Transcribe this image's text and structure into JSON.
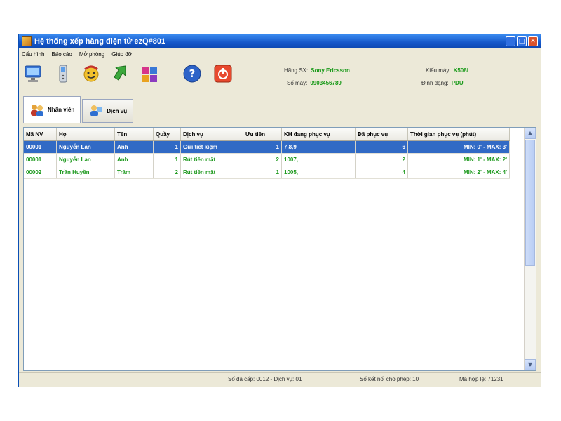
{
  "window": {
    "title": "Hệ thống xếp hàng điện tử ezQ#801"
  },
  "menu": [
    "Cấu hình",
    "Báo cáo",
    "Mở phòng",
    "Giúp đỡ"
  ],
  "toolbar": {
    "icons": [
      "monitor-icon",
      "phone-icon",
      "refresh-face-icon",
      "green-arrow-icon",
      "puzzle-icon",
      "help-icon",
      "power-icon"
    ]
  },
  "device_info": {
    "maker_label": "Hãng SX:",
    "maker_value": "Sony Ericsson",
    "phone_label": "Số máy:",
    "phone_value": "0903456789",
    "model_label": "Kiểu máy:",
    "model_value": "K508i",
    "format_label": "Định dạng:",
    "format_value": "PDU"
  },
  "tabs": [
    {
      "label": "Nhân viên",
      "active": true
    },
    {
      "label": "Dịch vụ",
      "active": false
    }
  ],
  "table": {
    "columns": [
      "Mã NV",
      "Họ",
      "Tên",
      "Quầy",
      "Dịch vụ",
      "Ưu tiên",
      "KH đang phục vụ",
      "Đã phục vụ",
      "Thời gian phục vụ (phút)"
    ],
    "rows": [
      [
        "00001",
        "Nguyễn Lan",
        "Anh",
        "1",
        "Gửi tiết kiệm",
        "1",
        "7,8,9",
        "6",
        "MIN: 0' - MAX: 3'"
      ],
      [
        "00001",
        "Nguyễn Lan",
        "Anh",
        "1",
        "Rút tiền mặt",
        "2",
        "1007,",
        "2",
        "MIN: 1' - MAX: 2'"
      ],
      [
        "00002",
        "Trần Huyền",
        "Trâm",
        "2",
        "Rút tiền mặt",
        "1",
        "1005,",
        "4",
        "MIN: 2' - MAX: 4'"
      ]
    ],
    "selected_row": 0
  },
  "status": {
    "calls": "Số đã cấp: 0012 - Dịch vụ: 01",
    "connections": "Số kết nối cho phép: 10",
    "license": "Mã hợp lệ: 71231"
  },
  "colors": {
    "accent": "#316ac5",
    "data_text": "#1f9a1f",
    "title_bar": "#1456c8"
  }
}
